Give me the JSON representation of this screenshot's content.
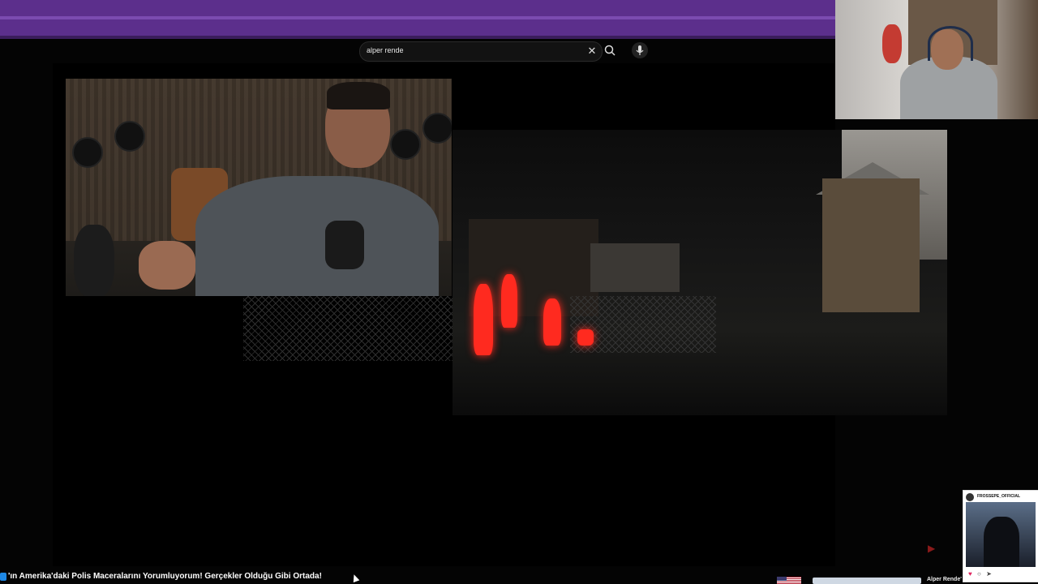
{
  "search": {
    "value": "alper rende"
  },
  "ticker": {
    "text": "'ın Amerika'daki Polis Maceralarını Yorumluyorum! Gerçekler Olduğu Gibi Ortada!"
  },
  "right_ticker": {
    "name": "Alper Rende'"
  },
  "instagram": {
    "username": "FROSSEPE_OFFICIAL"
  },
  "colors": {
    "topbar": "#5c2f8c",
    "thermal": "#ff2a1f"
  }
}
